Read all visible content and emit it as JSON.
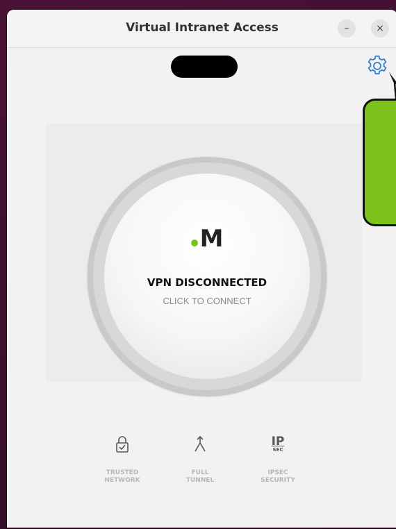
{
  "window": {
    "title": "Virtual Intranet Access",
    "minimize_label": "–",
    "close_label": "×"
  },
  "icons": {
    "settings": "gear-icon",
    "trusted_network": "lock-check-icon",
    "full_tunnel": "tunnel-split-icon",
    "ipsec": "ipsec-icon"
  },
  "brand": {
    "letter": "M",
    "dot_color": "#7cc21c"
  },
  "vpn": {
    "status": "VPN DISCONNECTED",
    "action_hint": "CLICK TO CONNECT"
  },
  "features": [
    {
      "label": "TRUSTED\nNETWORK"
    },
    {
      "label": "FULL\nTUNNEL"
    },
    {
      "label": "IPSEC\nSECURITY",
      "glyph_top": "IP",
      "glyph_bottom": "SEC"
    }
  ],
  "colors": {
    "accent_green": "#7cc21c",
    "icon_blue": "#2f7fd1"
  }
}
